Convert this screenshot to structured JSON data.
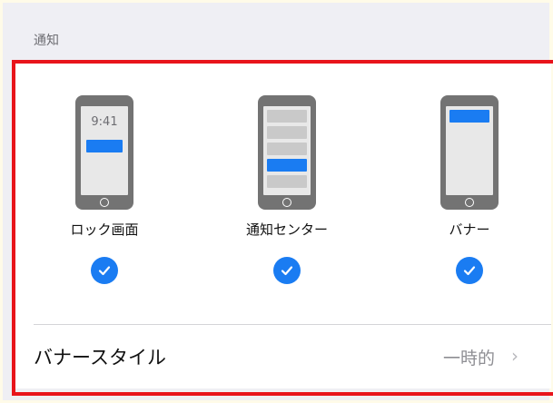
{
  "section_header": "通知",
  "options": [
    {
      "label": "ロック画面",
      "time": "9:41",
      "checked": true
    },
    {
      "label": "通知センター",
      "checked": true
    },
    {
      "label": "バナー",
      "checked": true
    }
  ],
  "banner_style": {
    "label": "バナースタイル",
    "value": "一時的",
    "chevron": "›"
  },
  "colors": {
    "accent": "#1a7cf2",
    "highlight": "#e8141b",
    "phone": "#737373"
  }
}
